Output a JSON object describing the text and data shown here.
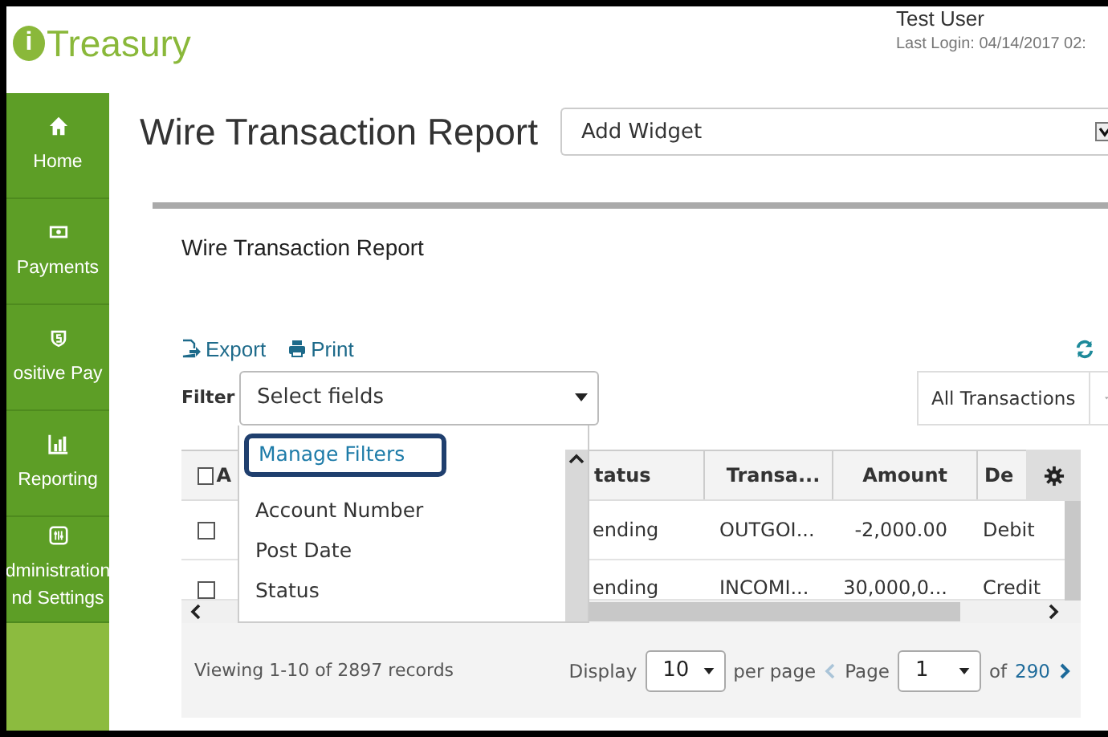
{
  "logo": {
    "mark": "i",
    "text": "Treasury"
  },
  "user": {
    "name": "Test User",
    "last_login": "Last Login: 04/14/2017 02:"
  },
  "sidebar": {
    "items": [
      {
        "label": "Home",
        "kind": "home"
      },
      {
        "label": "Payments",
        "kind": "payments"
      },
      {
        "label": "ositive Pay",
        "kind": "shield"
      },
      {
        "label": "Reporting",
        "kind": "chart"
      },
      {
        "label": "dministration\nnd Settings",
        "kind": "settings"
      }
    ]
  },
  "page_title": "Wire Transaction Report",
  "widget_select": {
    "value": "Add Widget"
  },
  "report": {
    "title": "Wire Transaction Report",
    "actions": [
      {
        "label": "Export",
        "kind": "export"
      },
      {
        "label": "Print",
        "kind": "print"
      }
    ],
    "filter": {
      "label": "Filter",
      "placeholder": "Select fields",
      "options": [
        {
          "label": "Manage Filters",
          "kind": "link",
          "highlighted": true
        },
        {
          "label": "Account Number",
          "kind": "item",
          "highlighted": false
        },
        {
          "label": "Post Date",
          "kind": "item",
          "highlighted": false
        },
        {
          "label": "Status",
          "kind": "item",
          "highlighted": false
        }
      ]
    },
    "transactions_select": {
      "value": "All Transactions"
    },
    "table": {
      "select_all": {
        "label": "A",
        "checked": false
      },
      "columns": [
        "tatus",
        "Transa...",
        "Amount",
        "De"
      ],
      "rows": [
        {
          "checked": false,
          "cells": [
            "ending",
            "OUTGOI...",
            "-2,000.00",
            "Debit"
          ]
        },
        {
          "checked": false,
          "cells": [
            "ending",
            "INCOMI...",
            "30,000,0...",
            "Credit"
          ]
        }
      ]
    },
    "footer": {
      "summary": "Viewing 1-10 of 2897 records",
      "display_label": "Display",
      "page_size": "10",
      "per_page": "per page",
      "page_label": "Page",
      "page": "1",
      "of_label": "of",
      "total_pages": "290"
    }
  }
}
